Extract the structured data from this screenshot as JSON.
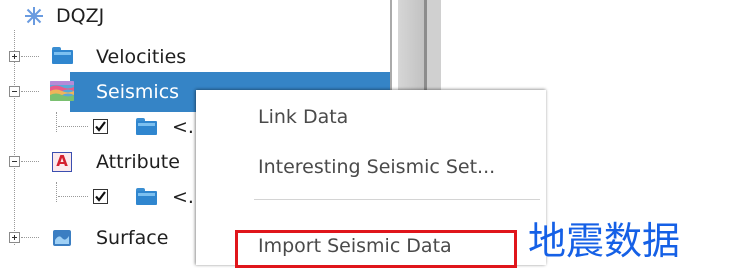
{
  "tree": {
    "root_label": "DQZJ",
    "items": [
      {
        "label": "Velocities",
        "expanded": false,
        "icon": "folder-icon"
      },
      {
        "label": "Seismics",
        "expanded": true,
        "selected": true,
        "icon": "seismic-icon"
      },
      {
        "label": "<..",
        "checked": true,
        "icon": "folder-icon"
      },
      {
        "label": "Attribute",
        "expanded": true,
        "icon": "attribute-icon"
      },
      {
        "label": "<..",
        "checked": true,
        "icon": "folder-icon"
      },
      {
        "label": "Surface",
        "expanded": false,
        "icon": "surface-icon"
      }
    ]
  },
  "context_menu": {
    "items": [
      "Link Data",
      "Interesting Seismic Set...",
      "Import Seismic Data"
    ],
    "highlighted_item": "Import Seismic Data"
  },
  "annotation": {
    "text": "地震数据",
    "color": "#1560e6",
    "box_color": "#e0151b"
  },
  "colors": {
    "selection": "#3584c6"
  }
}
